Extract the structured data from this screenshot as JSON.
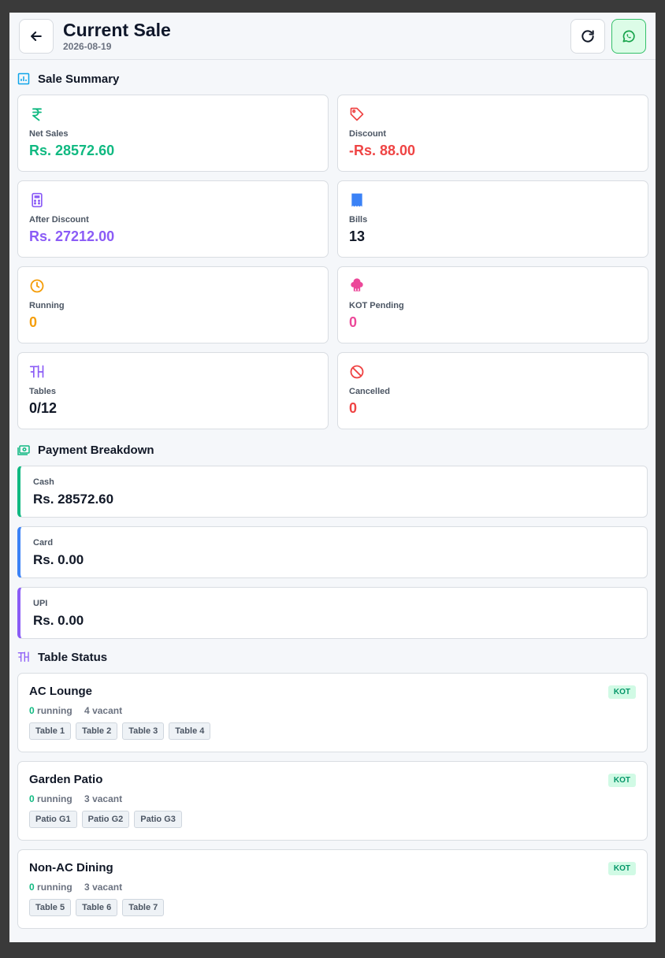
{
  "header": {
    "title": "Current Sale",
    "date": "2026-08-19"
  },
  "summary": {
    "title": "Sale Summary",
    "cards": [
      {
        "label": "Net Sales",
        "value": "Rs. 28572.60",
        "color": "#10b981",
        "icon": "rupee-icon"
      },
      {
        "label": "Discount",
        "value": "-Rs. 88.00",
        "color": "#ef4444",
        "icon": "tag-icon"
      },
      {
        "label": "After Discount",
        "value": "Rs. 27212.00",
        "color": "#8b5cf6",
        "icon": "calculator-icon"
      },
      {
        "label": "Bills",
        "value": "13",
        "color": "#111827",
        "icon": "receipt-icon"
      },
      {
        "label": "Running",
        "value": "0",
        "color": "#f59e0b",
        "icon": "clock-icon"
      },
      {
        "label": "KOT Pending",
        "value": "0",
        "color": "#ec4899",
        "icon": "chef-hat-icon"
      },
      {
        "label": "Tables",
        "value": "0/12",
        "color": "#111827",
        "icon": "table-icon"
      },
      {
        "label": "Cancelled",
        "value": "0",
        "color": "#ef4444",
        "icon": "ban-icon"
      }
    ]
  },
  "payments": {
    "title": "Payment Breakdown",
    "items": [
      {
        "label": "Cash",
        "value": "Rs. 28572.60",
        "accent": "#10b981"
      },
      {
        "label": "Card",
        "value": "Rs. 0.00",
        "accent": "#3b82f6"
      },
      {
        "label": "UPI",
        "value": "Rs. 0.00",
        "accent": "#8b5cf6"
      }
    ]
  },
  "tables": {
    "title": "Table Status",
    "running_label": "running",
    "vacant_label": "vacant",
    "areas": [
      {
        "name": "AC Lounge",
        "badge": "KOT",
        "running": "0",
        "vacant": "4",
        "tables": [
          "Table 1",
          "Table 2",
          "Table 3",
          "Table 4"
        ]
      },
      {
        "name": "Garden Patio",
        "badge": "KOT",
        "running": "0",
        "vacant": "3",
        "tables": [
          "Patio G1",
          "Patio G2",
          "Patio G3"
        ]
      },
      {
        "name": "Non-AC Dining",
        "badge": "KOT",
        "running": "0",
        "vacant": "3",
        "tables": [
          "Table 5",
          "Table 6",
          "Table 7"
        ]
      }
    ]
  }
}
